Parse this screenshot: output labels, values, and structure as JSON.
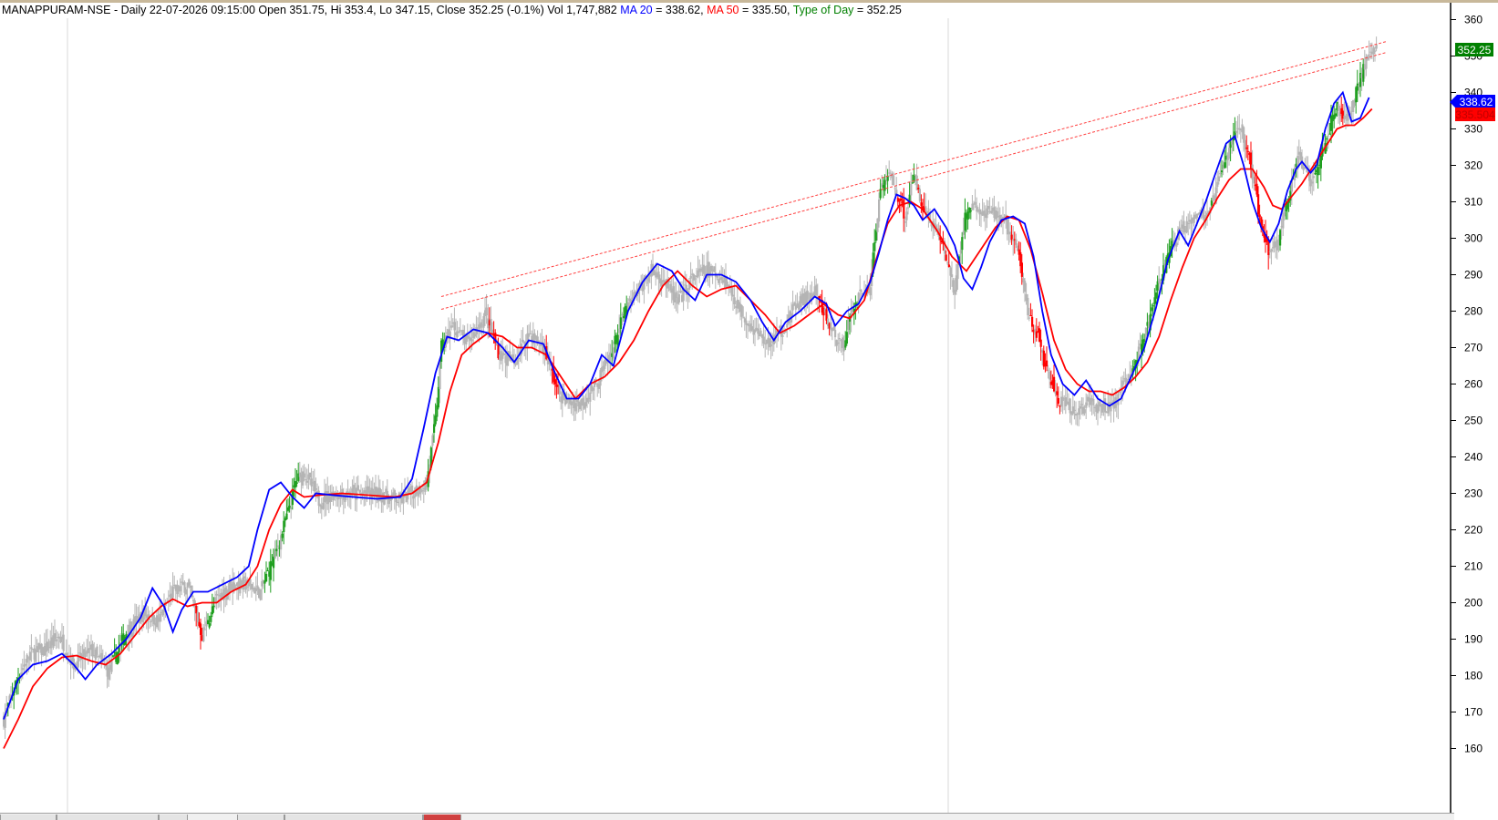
{
  "header": {
    "symbol": "MANAPPURAM-NSE",
    "info": " - Daily 22-07-2026 09:15:00 Open 351.75, Hi 353.4, Lo 347.15, Close 352.25 (-0.1%) Vol 1,747,882 ",
    "ma20_label": "MA 20",
    "ma20_value": " = 338.62, ",
    "ma50_label": "MA 50",
    "ma50_value": " = 335.50, ",
    "tod_label": "Type of Day",
    "tod_value": " = 352.25"
  },
  "colors": {
    "ma20": "#0000ff",
    "ma50": "#ff0000",
    "type_of_day": "#008000",
    "bull_candle": "#1e9e1e",
    "bear_candle": "#ff0000",
    "neutral_candle": "#b4b4b4",
    "trendline": "#ff4040",
    "price_tag": "#008000"
  },
  "price_tags": {
    "close": "352.25",
    "ma20": "338.62",
    "ma50": "335.504"
  },
  "chart_data": {
    "type": "line",
    "title": "MANAPPURAM-NSE Daily",
    "xlabel": "",
    "ylabel": "",
    "ylim": [
      156,
      362
    ],
    "y_ticks": [
      160,
      170,
      180,
      190,
      200,
      210,
      220,
      230,
      240,
      250,
      260,
      270,
      280,
      290,
      300,
      310,
      320,
      330,
      340,
      350,
      360
    ],
    "grid": false,
    "price_axis": "right",
    "close_path": [
      [
        0,
        168
      ],
      [
        10,
        180
      ],
      [
        18,
        186
      ],
      [
        28,
        187
      ],
      [
        38,
        191
      ],
      [
        48,
        183
      ],
      [
        60,
        187
      ],
      [
        72,
        181
      ],
      [
        84,
        192
      ],
      [
        96,
        197
      ],
      [
        106,
        195
      ],
      [
        116,
        203
      ],
      [
        126,
        205
      ],
      [
        136,
        191
      ],
      [
        146,
        201
      ],
      [
        156,
        205
      ],
      [
        166,
        205
      ],
      [
        176,
        203
      ],
      [
        186,
        213
      ],
      [
        196,
        226
      ],
      [
        200,
        233
      ],
      [
        206,
        236
      ],
      [
        216,
        228
      ],
      [
        226,
        230
      ],
      [
        240,
        230
      ],
      [
        256,
        230
      ],
      [
        272,
        228
      ],
      [
        290,
        233
      ],
      [
        296,
        250
      ],
      [
        300,
        270
      ],
      [
        308,
        276
      ],
      [
        318,
        271
      ],
      [
        330,
        279
      ],
      [
        340,
        268
      ],
      [
        350,
        266
      ],
      [
        360,
        274
      ],
      [
        370,
        270
      ],
      [
        380,
        258
      ],
      [
        386,
        255
      ],
      [
        396,
        255
      ],
      [
        406,
        260
      ],
      [
        416,
        268
      ],
      [
        426,
        280
      ],
      [
        434,
        285
      ],
      [
        444,
        291
      ],
      [
        452,
        289
      ],
      [
        462,
        282
      ],
      [
        472,
        289
      ],
      [
        482,
        291
      ],
      [
        494,
        289
      ],
      [
        504,
        281
      ],
      [
        514,
        275
      ],
      [
        524,
        271
      ],
      [
        534,
        275
      ],
      [
        544,
        282
      ],
      [
        556,
        285
      ],
      [
        566,
        276
      ],
      [
        574,
        270
      ],
      [
        584,
        283
      ],
      [
        594,
        287
      ],
      [
        600,
        311
      ],
      [
        606,
        318
      ],
      [
        612,
        313
      ],
      [
        618,
        306
      ],
      [
        624,
        317
      ],
      [
        632,
        307
      ],
      [
        640,
        302
      ],
      [
        646,
        295
      ],
      [
        652,
        285
      ],
      [
        658,
        304
      ],
      [
        664,
        310
      ],
      [
        670,
        306
      ],
      [
        680,
        307
      ],
      [
        688,
        303
      ],
      [
        696,
        295
      ],
      [
        702,
        280
      ],
      [
        708,
        274
      ],
      [
        716,
        262
      ],
      [
        724,
        255
      ],
      [
        734,
        252
      ],
      [
        744,
        255
      ],
      [
        752,
        253
      ],
      [
        762,
        255
      ],
      [
        772,
        263
      ],
      [
        782,
        272
      ],
      [
        790,
        285
      ],
      [
        800,
        297
      ],
      [
        808,
        303
      ],
      [
        816,
        307
      ],
      [
        826,
        306
      ],
      [
        834,
        317
      ],
      [
        842,
        327
      ],
      [
        848,
        331
      ],
      [
        856,
        318
      ],
      [
        862,
        303
      ],
      [
        868,
        296
      ],
      [
        874,
        300
      ],
      [
        880,
        311
      ],
      [
        888,
        322
      ],
      [
        896,
        316
      ],
      [
        902,
        322
      ],
      [
        908,
        329
      ],
      [
        914,
        337
      ],
      [
        918,
        333
      ],
      [
        924,
        335
      ],
      [
        930,
        345
      ],
      [
        936,
        350
      ],
      [
        941,
        352.25
      ]
    ],
    "series": [
      {
        "name": "MA 20",
        "values": [
          [
            0,
            168
          ],
          [
            10,
            179
          ],
          [
            20,
            183
          ],
          [
            30,
            184
          ],
          [
            40,
            186
          ],
          [
            48,
            183
          ],
          [
            56,
            179
          ],
          [
            64,
            183
          ],
          [
            74,
            186
          ],
          [
            84,
            190
          ],
          [
            94,
            196
          ],
          [
            102,
            204
          ],
          [
            110,
            199
          ],
          [
            116,
            192
          ],
          [
            122,
            198
          ],
          [
            130,
            203
          ],
          [
            140,
            203
          ],
          [
            150,
            205
          ],
          [
            160,
            207
          ],
          [
            168,
            210
          ],
          [
            174,
            220
          ],
          [
            182,
            231
          ],
          [
            190,
            233
          ],
          [
            198,
            229
          ],
          [
            206,
            226
          ],
          [
            214,
            230
          ],
          [
            226,
            229.5
          ],
          [
            240,
            229
          ],
          [
            256,
            228.5
          ],
          [
            272,
            229
          ],
          [
            280,
            234
          ],
          [
            288,
            248
          ],
          [
            296,
            263
          ],
          [
            304,
            273
          ],
          [
            312,
            272
          ],
          [
            322,
            275
          ],
          [
            332,
            274
          ],
          [
            342,
            270
          ],
          [
            350,
            266
          ],
          [
            360,
            272
          ],
          [
            370,
            271
          ],
          [
            378,
            263
          ],
          [
            386,
            256
          ],
          [
            394,
            256
          ],
          [
            402,
            260
          ],
          [
            410,
            268
          ],
          [
            418,
            265
          ],
          [
            428,
            280
          ],
          [
            438,
            288
          ],
          [
            448,
            293
          ],
          [
            458,
            291
          ],
          [
            466,
            286
          ],
          [
            474,
            283
          ],
          [
            482,
            290
          ],
          [
            492,
            290
          ],
          [
            502,
            288
          ],
          [
            512,
            283
          ],
          [
            520,
            277
          ],
          [
            528,
            272
          ],
          [
            536,
            277
          ],
          [
            546,
            280
          ],
          [
            556,
            284
          ],
          [
            564,
            282
          ],
          [
            570,
            276
          ],
          [
            578,
            280
          ],
          [
            586,
            282
          ],
          [
            594,
            288
          ],
          [
            600,
            296
          ],
          [
            606,
            305
          ],
          [
            612,
            312
          ],
          [
            618,
            311
          ],
          [
            624,
            309
          ],
          [
            630,
            305
          ],
          [
            638,
            308
          ],
          [
            646,
            303
          ],
          [
            652,
            298
          ],
          [
            658,
            289
          ],
          [
            664,
            286
          ],
          [
            670,
            292
          ],
          [
            676,
            299
          ],
          [
            684,
            305
          ],
          [
            692,
            306
          ],
          [
            700,
            304
          ],
          [
            706,
            295
          ],
          [
            712,
            280
          ],
          [
            718,
            268
          ],
          [
            726,
            260
          ],
          [
            734,
            257
          ],
          [
            742,
            261
          ],
          [
            750,
            256
          ],
          [
            758,
            254
          ],
          [
            766,
            256
          ],
          [
            774,
            263
          ],
          [
            782,
            270
          ],
          [
            790,
            281
          ],
          [
            798,
            294
          ],
          [
            806,
            302
          ],
          [
            812,
            298
          ],
          [
            818,
            304
          ],
          [
            824,
            310
          ],
          [
            830,
            317
          ],
          [
            838,
            326
          ],
          [
            844,
            328
          ],
          [
            850,
            320
          ],
          [
            856,
            310
          ],
          [
            862,
            303
          ],
          [
            868,
            299
          ],
          [
            874,
            304
          ],
          [
            880,
            313
          ],
          [
            886,
            319
          ],
          [
            890,
            321
          ],
          [
            896,
            318
          ],
          [
            900,
            320
          ],
          [
            906,
            330
          ],
          [
            912,
            337
          ],
          [
            918,
            340
          ],
          [
            924,
            332
          ],
          [
            930,
            333
          ],
          [
            936,
            338.62
          ]
        ]
      },
      {
        "name": "MA 50",
        "values": [
          [
            0,
            160
          ],
          [
            10,
            168
          ],
          [
            20,
            177
          ],
          [
            30,
            182
          ],
          [
            40,
            185
          ],
          [
            50,
            185.5
          ],
          [
            60,
            184
          ],
          [
            70,
            183
          ],
          [
            80,
            186
          ],
          [
            90,
            191
          ],
          [
            100,
            196
          ],
          [
            108,
            199
          ],
          [
            116,
            201
          ],
          [
            126,
            199
          ],
          [
            136,
            200
          ],
          [
            146,
            200
          ],
          [
            156,
            203
          ],
          [
            166,
            205
          ],
          [
            174,
            210
          ],
          [
            182,
            220
          ],
          [
            190,
            227
          ],
          [
            198,
            231
          ],
          [
            206,
            229
          ],
          [
            216,
            229.5
          ],
          [
            232,
            230
          ],
          [
            250,
            229.5
          ],
          [
            268,
            229
          ],
          [
            280,
            230
          ],
          [
            290,
            233
          ],
          [
            298,
            244
          ],
          [
            306,
            258
          ],
          [
            314,
            268
          ],
          [
            322,
            271
          ],
          [
            332,
            274
          ],
          [
            342,
            273
          ],
          [
            352,
            270
          ],
          [
            362,
            270
          ],
          [
            372,
            268
          ],
          [
            382,
            262
          ],
          [
            392,
            256
          ],
          [
            402,
            260
          ],
          [
            412,
            262
          ],
          [
            422,
            266
          ],
          [
            432,
            272
          ],
          [
            442,
            280
          ],
          [
            452,
            287
          ],
          [
            462,
            291
          ],
          [
            472,
            287
          ],
          [
            482,
            284
          ],
          [
            492,
            286
          ],
          [
            502,
            287
          ],
          [
            512,
            283
          ],
          [
            522,
            279
          ],
          [
            532,
            274
          ],
          [
            542,
            276
          ],
          [
            552,
            279
          ],
          [
            562,
            282
          ],
          [
            572,
            279
          ],
          [
            580,
            278
          ],
          [
            590,
            283
          ],
          [
            598,
            294
          ],
          [
            606,
            304
          ],
          [
            614,
            309
          ],
          [
            622,
            310
          ],
          [
            630,
            308
          ],
          [
            640,
            302
          ],
          [
            650,
            295
          ],
          [
            660,
            291
          ],
          [
            670,
            297
          ],
          [
            680,
            303
          ],
          [
            688,
            306
          ],
          [
            696,
            305
          ],
          [
            704,
            297
          ],
          [
            712,
            285
          ],
          [
            720,
            272
          ],
          [
            728,
            264
          ],
          [
            736,
            260
          ],
          [
            744,
            258
          ],
          [
            752,
            258
          ],
          [
            760,
            257
          ],
          [
            768,
            259
          ],
          [
            776,
            262
          ],
          [
            784,
            266
          ],
          [
            792,
            273
          ],
          [
            800,
            283
          ],
          [
            808,
            292
          ],
          [
            816,
            300
          ],
          [
            824,
            305
          ],
          [
            832,
            311
          ],
          [
            840,
            316
          ],
          [
            848,
            319
          ],
          [
            856,
            319
          ],
          [
            864,
            314
          ],
          [
            870,
            309
          ],
          [
            876,
            308
          ],
          [
            882,
            311
          ],
          [
            890,
            315
          ],
          [
            898,
            320
          ],
          [
            906,
            325
          ],
          [
            914,
            330
          ],
          [
            920,
            331
          ],
          [
            926,
            331
          ],
          [
            932,
            333
          ],
          [
            938,
            335.5
          ]
        ]
      }
    ],
    "trendlines": [
      {
        "from": [
          300,
          284
        ],
        "to": [
          948,
          354
        ]
      },
      {
        "from": [
          300,
          280.5
        ],
        "to": [
          948,
          351
        ]
      }
    ]
  }
}
